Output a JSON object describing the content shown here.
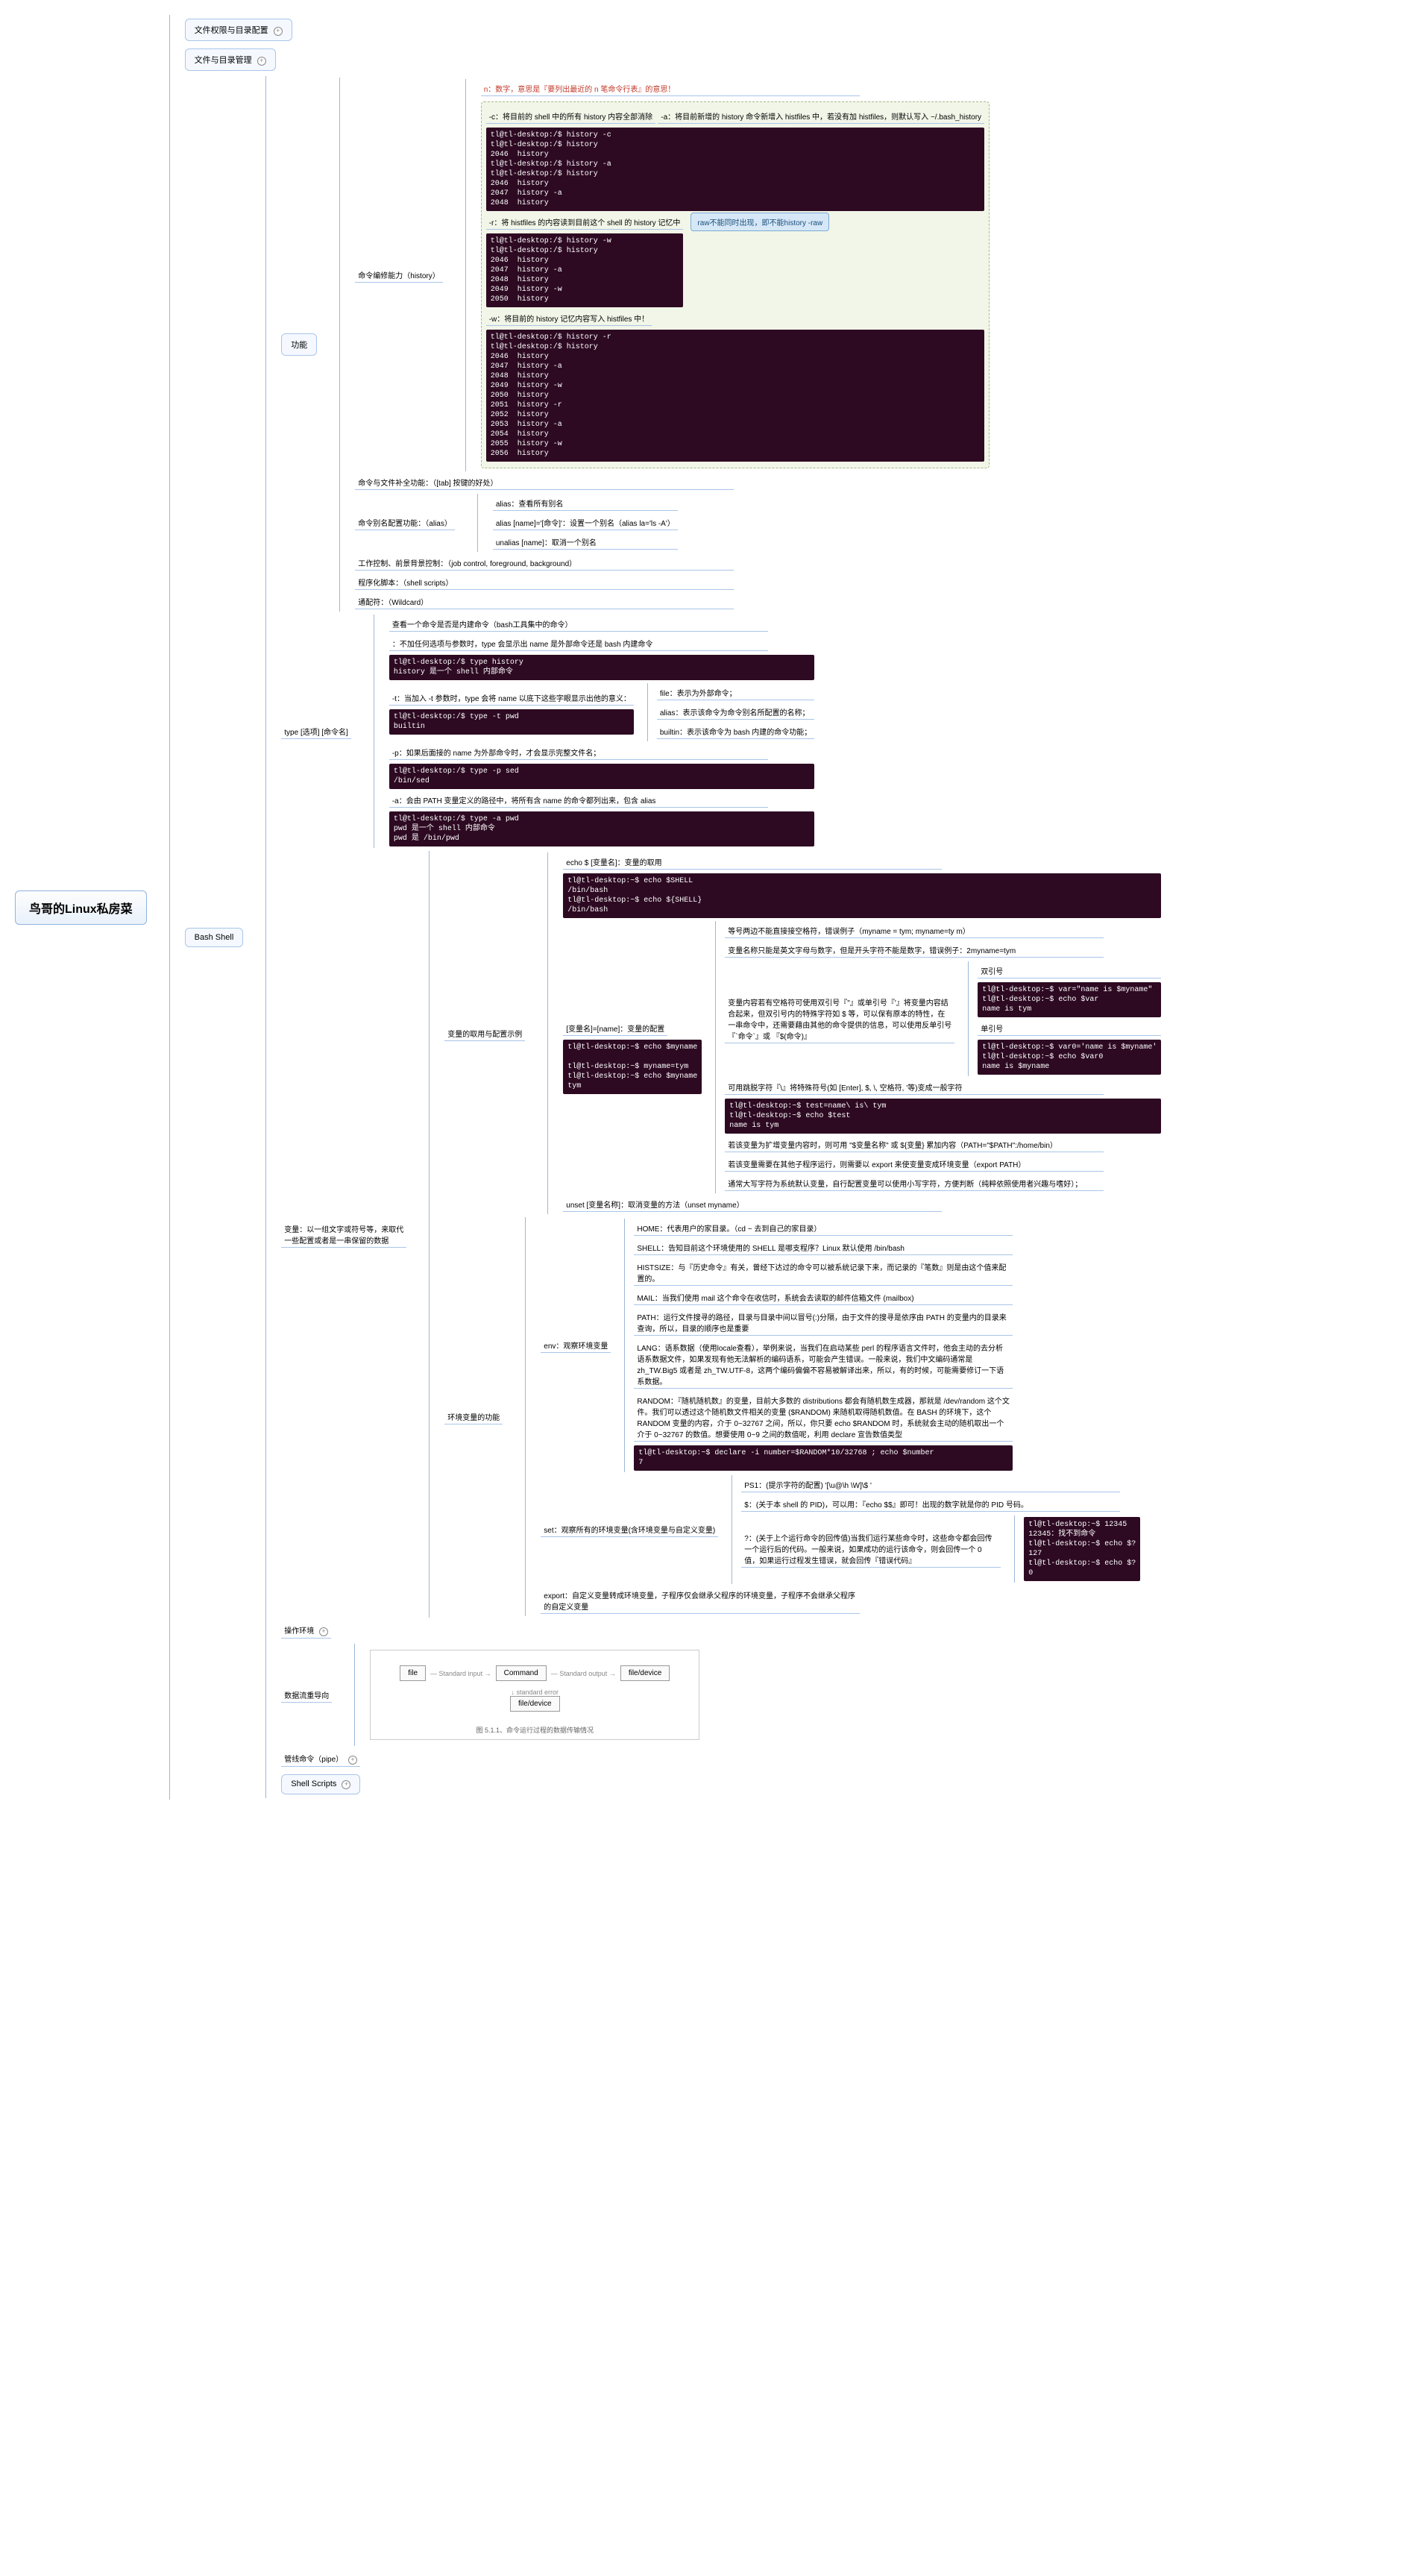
{
  "root": "鸟哥的Linux私房菜",
  "top_nodes": {
    "perm": "文件权限与目录配置",
    "mgmt": "文件与目录管理"
  },
  "bash": {
    "label": "Bash Shell",
    "func": {
      "label": "功能",
      "history": {
        "label": "命令编修能力（history）",
        "n": "n：数字，意思是『要列出最近的 n 笔命令行表』的意思！",
        "c": "-c：将目前的 shell 中的所有 history 内容全部消除",
        "a": "-a：将目前新增的 history 命令新增入 histfiles 中，若没有加 histfiles，则默认写入 ~/.bash_history",
        "a_term": "tl@tl-desktop:/$ history -c\ntl@tl-desktop:/$ history\n2046  history\ntl@tl-desktop:/$ history -a\ntl@tl-desktop:/$ history\n2046  history\n2047  history -a\n2048  history",
        "r": "-r：将 histfiles 的内容读到目前这个 shell 的 history 记忆中",
        "r_term": "tl@tl-desktop:/$ history -w\ntl@tl-desktop:/$ history\n2046  history\n2047  history -a\n2048  history\n2049  history -w\n2050  history",
        "r_callout": "raw不能同时出现，即不能history -raw",
        "w": "-w：将目前的 history 记忆内容写入 histfiles 中！",
        "w_term": "tl@tl-desktop:/$ history -r\ntl@tl-desktop:/$ history\n2046  history\n2047  history -a\n2048  history\n2049  history -w\n2050  history\n2051  history -r\n2052  history\n2053  history -a\n2054  history\n2055  history -w\n2056  history"
      },
      "tab": "命令与文件补全功能：（[tab] 按键的好处）",
      "alias": {
        "label": "命令别名配置功能：（alias）",
        "a": "alias：查看所有别名",
        "b": "alias [name]='[命令]'：设置一个别名（alias la='ls -A'）",
        "c": "unalias [name]：取消一个别名"
      },
      "job": "工作控制、前景背景控制：（job control, foreground, background）",
      "script": "程序化脚本：（shell scripts）",
      "wildcard": "通配符：（Wildcard）"
    },
    "type": {
      "label": "type [选项] [命令名]",
      "head": "查看一个命令是否是内建命令（bash工具集中的命令）",
      "no_opt": "：不加任何选项与参数时，type 会显示出 name 是外部命令还是 bash 内建命令",
      "no_opt_term": "tl@tl-desktop:/$ type history\nhistory 是一个 shell 内部命令",
      "t": "-t：当加入 -t 参数时，type 会将 name 以底下这些字眼显示出他的意义：",
      "t_term": "tl@tl-desktop:/$ type -t pwd\nbuiltin",
      "t_file": "file：表示为外部命令；",
      "t_alias": "alias：表示该命令为命令别名所配置的名称；",
      "t_builtin": "builtin：表示该命令为 bash 内建的命令功能；",
      "p": "-p：如果后面接的 name 为外部命令时，才会显示完整文件名；",
      "p_term": "tl@tl-desktop:/$ type -p sed\n/bin/sed",
      "a": "-a：会由 PATH 变量定义的路径中，将所有含 name 的命令都列出来，包含 alias",
      "a_term": "tl@tl-desktop:/$ type -a pwd\npwd 是一个 shell 内部命令\npwd 是 /bin/pwd"
    },
    "var": {
      "label": "变量：以一组文字或符号等，来取代一些配置或者是一串保留的数据",
      "example": {
        "label": "变量的取用与配置示例",
        "echo": {
          "label": "echo $ [变量名]：变量的取用",
          "term": "tl@tl-desktop:~$ echo $SHELL\n/bin/bash\ntl@tl-desktop:~$ echo ${SHELL}\n/bin/bash"
        },
        "assign": {
          "label": "[变量名]=[name]：变量的配置",
          "term": "tl@tl-desktop:~$ echo $myname\n\ntl@tl-desktop:~$ myname=tym\ntl@tl-desktop:~$ echo $myname\ntym",
          "rule1": "等号两边不能直接接空格符，错误例子（myname = tym; myname=ty m）",
          "rule2": "变量名称只能是英文字母与数字，但是开头字符不能是数字，错误例子：2myname=tym",
          "rule3": "变量内容若有空格符可使用双引号『\"』或单引号『'』将变量内容结合起来，但双引号内的特殊字符如 $ 等，可以保有原本的特性，在一串命令中，还需要藉由其他的命令提供的信息，可以使用反单引号『`命令`』或 『$(命令)』",
          "dq_label": "双引号",
          "dq_term": "tl@tl-desktop:~$ var=\"name is $myname\"\ntl@tl-desktop:~$ echo $var\nname is tym",
          "sq_label": "单引号",
          "sq_term": "tl@tl-desktop:~$ var0='name is $myname'\ntl@tl-desktop:~$ echo $var0\nname is $myname",
          "rule4": "可用跳脱字符『\\』将特殊符号(如 [Enter], $, \\, 空格符, '等)变成一般字符",
          "rule4_term": "tl@tl-desktop:~$ test=name\\ is\\ tym\ntl@tl-desktop:~$ echo $test\nname is tym",
          "rule5": "若该变量为扩增变量内容时，则可用 \"$变量名称\" 或 ${变量} 累加内容（PATH=\"$PATH\":/home/bin）",
          "rule6": "若该变量需要在其他子程序运行，则需要以 export 来使变量变成环境变量（export PATH）",
          "rule7": "通常大写字符为系统默认变量，自行配置变量可以使用小写字符，方便判断（纯粹依照使用者兴趣与嗜好）；"
        },
        "unset": "unset [变量名称]：取消变量的方法（unset myname）"
      },
      "envfunc": {
        "label": "环境变量的功能",
        "env": {
          "label": "env：观察环境变量",
          "home": "HOME：代表用户的家目录。（cd ~ 去到自己的家目录）",
          "shell": "SHELL：告知目前这个环境使用的 SHELL 是哪支程序？Linux 默认使用 /bin/bash",
          "histsize": "HISTSIZE：与『历史命令』有关，曾经下达过的命令可以被系统记录下来，而记录的『笔数』则是由这个值来配置的。",
          "mail": "MAIL：当我们使用 mail 这个命令在收信时，系统会去读取的邮件信箱文件 (mailbox)",
          "path": "PATH：运行文件搜寻的路径，目录与目录中间以冒号(:)分隔，由于文件的搜寻是依序由 PATH 的变量内的目录来查询，所以，目录的顺序也是重要",
          "lang": "LANG：语系数据（使用locale查看），举例来说，当我们在启动某些 perl 的程序语言文件时，他会主动的去分析语系数据文件，如果发现有他无法解析的编码语系，可能会产生错误。一般来说，我们中文编码通常是 zh_TW.Big5 或者是 zh_TW.UTF-8，这两个编码偏偏不容易被解译出来，所以，有的时候，可能需要修订一下语系数据。",
          "random": "RANDOM：『随机随机数』的变量，目前大多数的 distributions 都会有随机数生成器，那就是 /dev/random 这个文件。我们可以透过这个随机数文件相关的变量 ($RANDOM) 来随机取得随机数值。在 BASH 的环境下，这个 RANDOM 变量的内容，介于 0~32767 之间，所以，你只要 echo $RANDOM 时，系统就会主动的随机取出一个介于 0~32767 的数值。想要使用 0~9 之间的数值呢，利用 declare 宣告数值类型",
          "random_term": "tl@tl-desktop:~$ declare -i number=$RANDOM*10/32768 ; echo $number\n7"
        },
        "set": {
          "label": "set：观察所有的环境变量(含环境变量与自定义变量)",
          "ps1": "PS1：(提示字符的配置) '[\\u@\\h \\W]\\$ '",
          "dollar": "$：(关于本 shell 的 PID)，可以用：『echo $$』即可！出现的数字就是你的 PID 号码。",
          "qmark": "?：(关于上个运行命令的回传值)当我们运行某些命令时，这些命令都会回传一个运行后的代码。一般来说，如果成功的运行该命令，则会回传一个 0 值，如果运行过程发生错误，就会回传『错误代码』",
          "qmark_term": "tl@tl-desktop:~$ 12345\n12345：找不到命令\ntl@tl-desktop:~$ echo $?\n127\ntl@tl-desktop:~$ echo $?\n0"
        },
        "export": "export：自定义变量转成环境变量，子程序仅会继承父程序的环境变量，子程序不会继承父程序的自定义变量"
      }
    },
    "openv": "操作环境",
    "redirect": {
      "label": "数据流重导向",
      "caption": "图 5.1.1、命令运行过程的数据传输情况",
      "file": "file",
      "cmd": "Command",
      "filedev": "file/device",
      "stdin": "Standard input",
      "stdout": "Standard output",
      "stderr": "standard error"
    },
    "pipe": "管线命令（pipe）",
    "scripts": "Shell Scripts"
  }
}
